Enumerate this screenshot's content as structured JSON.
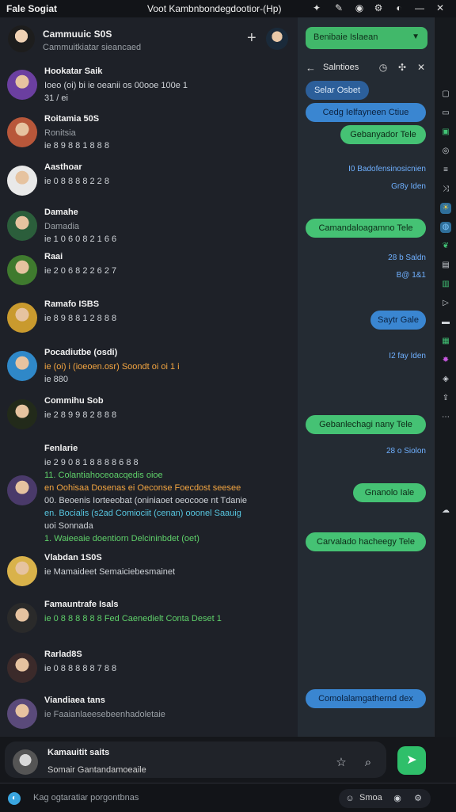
{
  "topbar": {
    "app_title": "Fale Sogiat",
    "window_title": "Voot Kambnbondegdootior-(Hp)"
  },
  "left_header": {
    "title": "Cammuuic S0S",
    "subtitle": "Cammuitkiatar sieancaed"
  },
  "chats": [
    {
      "name": "Hookatar Saik",
      "lines": [
        {
          "text": "Ioeo (oi) bi ie oeanii os 00ooe 100e 1",
          "color": "default"
        },
        {
          "text": "  31 / ei",
          "color": "default"
        }
      ],
      "avatar": "#6b3fa0"
    },
    {
      "name": "Roitamia 50S",
      "lines": [
        {
          "text": "Ronitsia",
          "color": "muted"
        },
        {
          "text": "ie 8 9 8 8 1 8 8 8",
          "color": "default"
        }
      ],
      "avatar": "#b8573a"
    },
    {
      "name": "Aasthoar",
      "lines": [
        {
          "text": "ie 0 8 8 8 8 2 2 8",
          "color": "default"
        }
      ],
      "avatar": "#e9e9e9"
    },
    {
      "name": "Damahe",
      "lines": [
        {
          "text": "Damadia",
          "color": "muted"
        },
        {
          "text": "ie 1 0 6 0 8 2 1 6 6",
          "color": "default"
        }
      ],
      "avatar": "#2b5e3b"
    },
    {
      "name": "Raai",
      "lines": [
        {
          "text": "ie 2 0 6 8 2 2 6 2 7",
          "color": "default"
        }
      ],
      "avatar": "#3f7a2e"
    },
    {
      "name": "Ramafo ISBS",
      "lines": [
        {
          "text": "ie 8 9 8 8 1 2 8 8 8",
          "color": "default"
        }
      ],
      "avatar": "#c99a2e"
    },
    {
      "name": "Pocadiutbe (osdi)",
      "lines": [
        {
          "text": "ie (oi) i (ioeoen.osr) Soondt oi oi 1 i",
          "color": "orange"
        },
        {
          "text": "ie 880",
          "color": "default"
        }
      ],
      "avatar": "#2f88c8"
    },
    {
      "name": "Commihu Sob",
      "lines": [
        {
          "text": "ie 2 8 9 9 8 2 8 8 8",
          "color": "default"
        }
      ],
      "avatar": "#222a1a"
    },
    {
      "name": "Fenlarie",
      "lines": [
        {
          "text": "ie 2 9 0 8 1 8 8 8 8 6 8 8",
          "color": "default"
        },
        {
          "text": "11. Colantiahoceoacqedis oioe",
          "color": "green"
        },
        {
          "text": "en Oohisaa Dosenas ei Oeconse Foecdost seesee",
          "color": "orange"
        },
        {
          "text": "00. Beoenis Iorteeobat (oniniaoet oeocooe nt Tdanie",
          "color": "default"
        },
        {
          "text": "en. Bocialis (s2ad Comiociit (cenan) ooonel Saauig",
          "color": "cyan"
        },
        {
          "text": "uoi Sonnada",
          "color": "default"
        },
        {
          "text": "1. Waieeaie doentiorn Delcininbdet (oet)",
          "color": "green"
        }
      ],
      "avatar": "#4a3a6a"
    },
    {
      "name": "Vlabdan 1S0S",
      "lines": [
        {
          "text": "ie Mamaideet Semaiciebesmainet",
          "color": "default"
        }
      ],
      "avatar": "#d9b24a"
    },
    {
      "name": "Famauntrafe Isals",
      "lines": [
        {
          "text": "ie 0 8 8 8 8 8 8 Fed Caenedielt Conta Deset 1",
          "color": "green"
        }
      ],
      "avatar": "#2a2a2a"
    },
    {
      "name": "Rarlad8S",
      "lines": [
        {
          "text": "ie 0 8 8 8 8 8 7 8 8",
          "color": "default"
        }
      ],
      "avatar": "#3b2a2a"
    },
    {
      "name": "Viandiaea tans",
      "lines": [
        {
          "text": "ie Faaianlaeesebeenhadoletaie",
          "color": "muted"
        }
      ],
      "avatar": "#5a4a7a"
    }
  ],
  "composer": {
    "name": "Kamauitit saits",
    "text": "Somair Gantandamoeaile"
  },
  "statusbar": {
    "placeholder": "Kag ogtaratiar porgontbnas",
    "label": "Smoa"
  },
  "right_pane": {
    "dropdown": "Benibaie Islaean",
    "title": "Salntioes",
    "messages": [
      {
        "type": "navy",
        "text": "Selar Osbet"
      },
      {
        "type": "blue",
        "text": "Cedg Ielfayneen Ctiue"
      },
      {
        "type": "green",
        "text": "Gebanyador Tele"
      },
      {
        "type": "meta",
        "text": "I0 Badofensinosicnien"
      },
      {
        "type": "meta",
        "text": "Gr8y Iden"
      },
      {
        "type": "green",
        "text": "Camandaloagamno Tele"
      },
      {
        "type": "meta",
        "text": "28 b Saldn"
      },
      {
        "type": "meta",
        "text": "B@ 1&1"
      },
      {
        "type": "blue",
        "text": "Saytr Gale"
      },
      {
        "type": "meta",
        "text": "I2 fay Iden"
      },
      {
        "type": "green",
        "text": "Gebanlechagi nany Tele"
      },
      {
        "type": "meta",
        "text": "28 o Siolon"
      },
      {
        "type": "green",
        "text": "Gnanolo Iale"
      },
      {
        "type": "green",
        "text": "Carvalado hacheegy Tele"
      },
      {
        "type": "blue",
        "text": "Comolalamgathernd dex"
      }
    ]
  },
  "colors": {
    "accent_green": "#45c274",
    "accent_blue": "#3a86d1",
    "background": "#1e2128"
  }
}
